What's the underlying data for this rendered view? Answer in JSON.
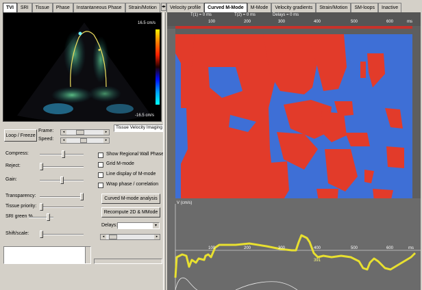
{
  "left_tabs": [
    "TVI",
    "SRI",
    "Tissue",
    "Phase",
    "Instantaneous Phase",
    "Strain/Motion"
  ],
  "left_tab_arrow": "◂▸",
  "right_tabs": [
    "Velocity profile",
    "Curved M-Mode",
    "M-Mode",
    "Velocity gradients",
    "Strain/Motion",
    "SM-loops",
    "Inactive"
  ],
  "echo": {
    "scale_top": "16.5 cm/s",
    "scale_bottom": "-16.5 cm/s"
  },
  "controls": {
    "loop_freeze": "Loop / Freeze",
    "frame_label": "Frame:",
    "speed_label": "Speed:",
    "mode_label": "Tissue Velocity Imaging",
    "compress_label": "Compress:",
    "reject_label": "Reject:",
    "gain_label": "Gain:",
    "transparency_label": "Transparency:",
    "tissue_priority_label": "Tissue priority:",
    "sri_green_label": "SRI green %",
    "shift_scale_label": "Shift/scale:",
    "show_regional_label": "Show Regional Wall Phase",
    "grid_mmode_label": "Grid M-mode",
    "line_display_label": "Line display of M-mode",
    "wrap_phase_label": "Wrap phase / correlation",
    "curved_analysis_btn": "Curved M-mode analysis",
    "recompute_btn": "Recompute 2D & MMode",
    "delays_label": "Delays:"
  },
  "mmode": {
    "header_t1": "T(1) = 0 ms",
    "header_t2": "T(2) = 0 ms",
    "header_delays": "Delays = 0 ms",
    "top_ticks": [
      "100",
      "200",
      "300",
      "400",
      "500",
      "600",
      "ms"
    ],
    "graph_label": "V (cm/s)",
    "graph_ticks": [
      "100",
      "200",
      "300",
      "400",
      "500",
      "600",
      "ms"
    ],
    "marker_value": "391"
  },
  "colors": {
    "panel": "#d4d0c8",
    "mmode_red": "#e23b2a",
    "mmode_blue": "#3e6fd6",
    "curve_yellow": "#e8e030",
    "graph_bg": "#6b6b6b"
  }
}
